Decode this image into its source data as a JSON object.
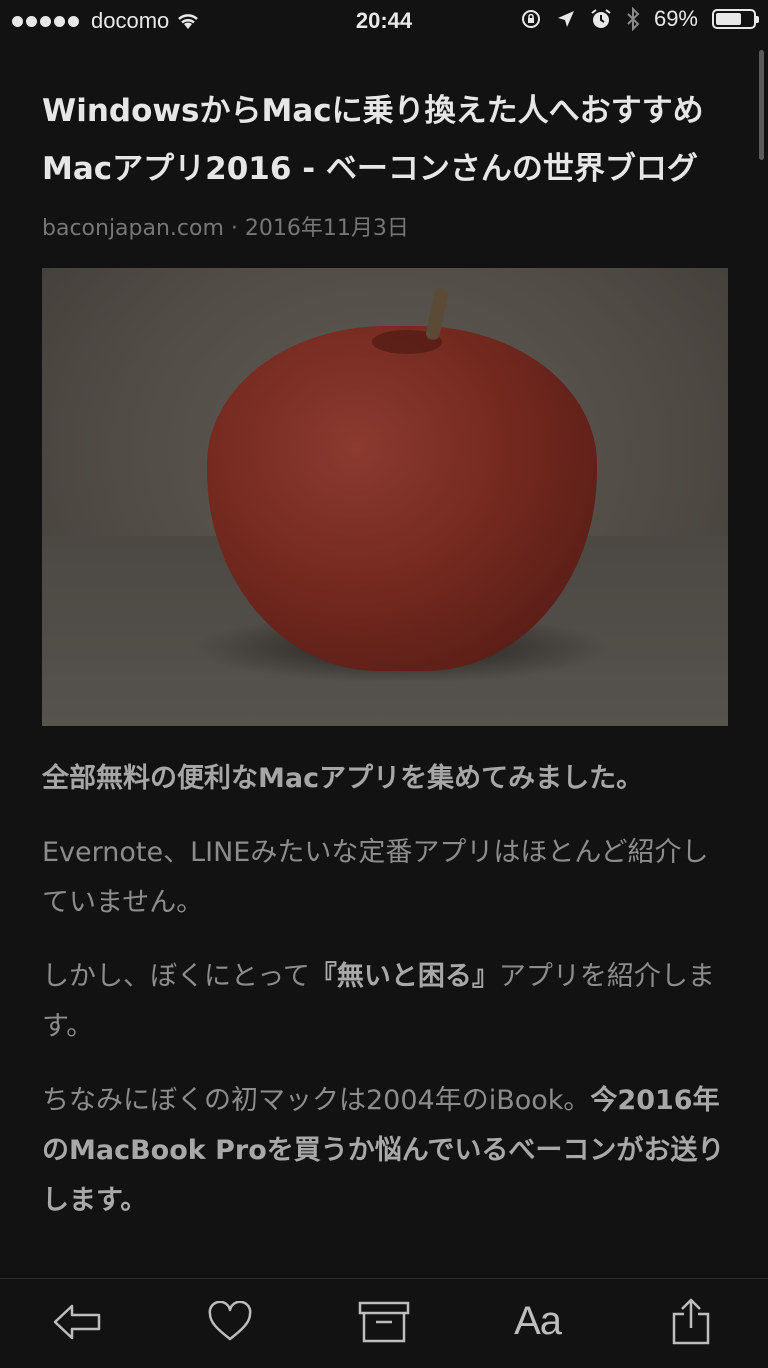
{
  "status_bar": {
    "carrier": "docomo",
    "time": "20:44",
    "battery_percent": "69%",
    "battery_level": 0.69,
    "icons": [
      "signal-dots",
      "wifi-icon",
      "lock-rotation-icon",
      "location-icon",
      "alarm-icon",
      "bluetooth-icon",
      "battery-icon"
    ]
  },
  "article": {
    "title": "WindowsからMacに乗り換えた人へおすすめMacアプリ2016 - ベーコンさんの世界ブログ",
    "source": "baconjapan.com",
    "separator": " · ",
    "date": "2016年11月3日",
    "hero_image": "apple-photo",
    "lead": "全部無料の便利なMacアプリを集めてみました。",
    "para1": "Evernote、LINEみたいな定番アプリはほとんど紹介していません。",
    "para2_before": "しかし、ぼくにとって",
    "para2_bold": "『無いと困る』",
    "para2_after": "アプリを紹介します。",
    "para3_before": "ちなみにぼくの初マックは2004年のiBook。",
    "para3_bold": "今2016年のMacBook Proを買うか悩んでいるべーコンがお送りします。"
  },
  "toolbar": {
    "back_icon": "arrow-left-icon",
    "like_icon": "heart-icon",
    "archive_icon": "archive-box-icon",
    "font_label": "Aa",
    "share_icon": "share-icon"
  },
  "colors": {
    "background": "#121212",
    "title": "#e6e6e6",
    "body": "#8c8c8c",
    "meta": "#767676"
  }
}
